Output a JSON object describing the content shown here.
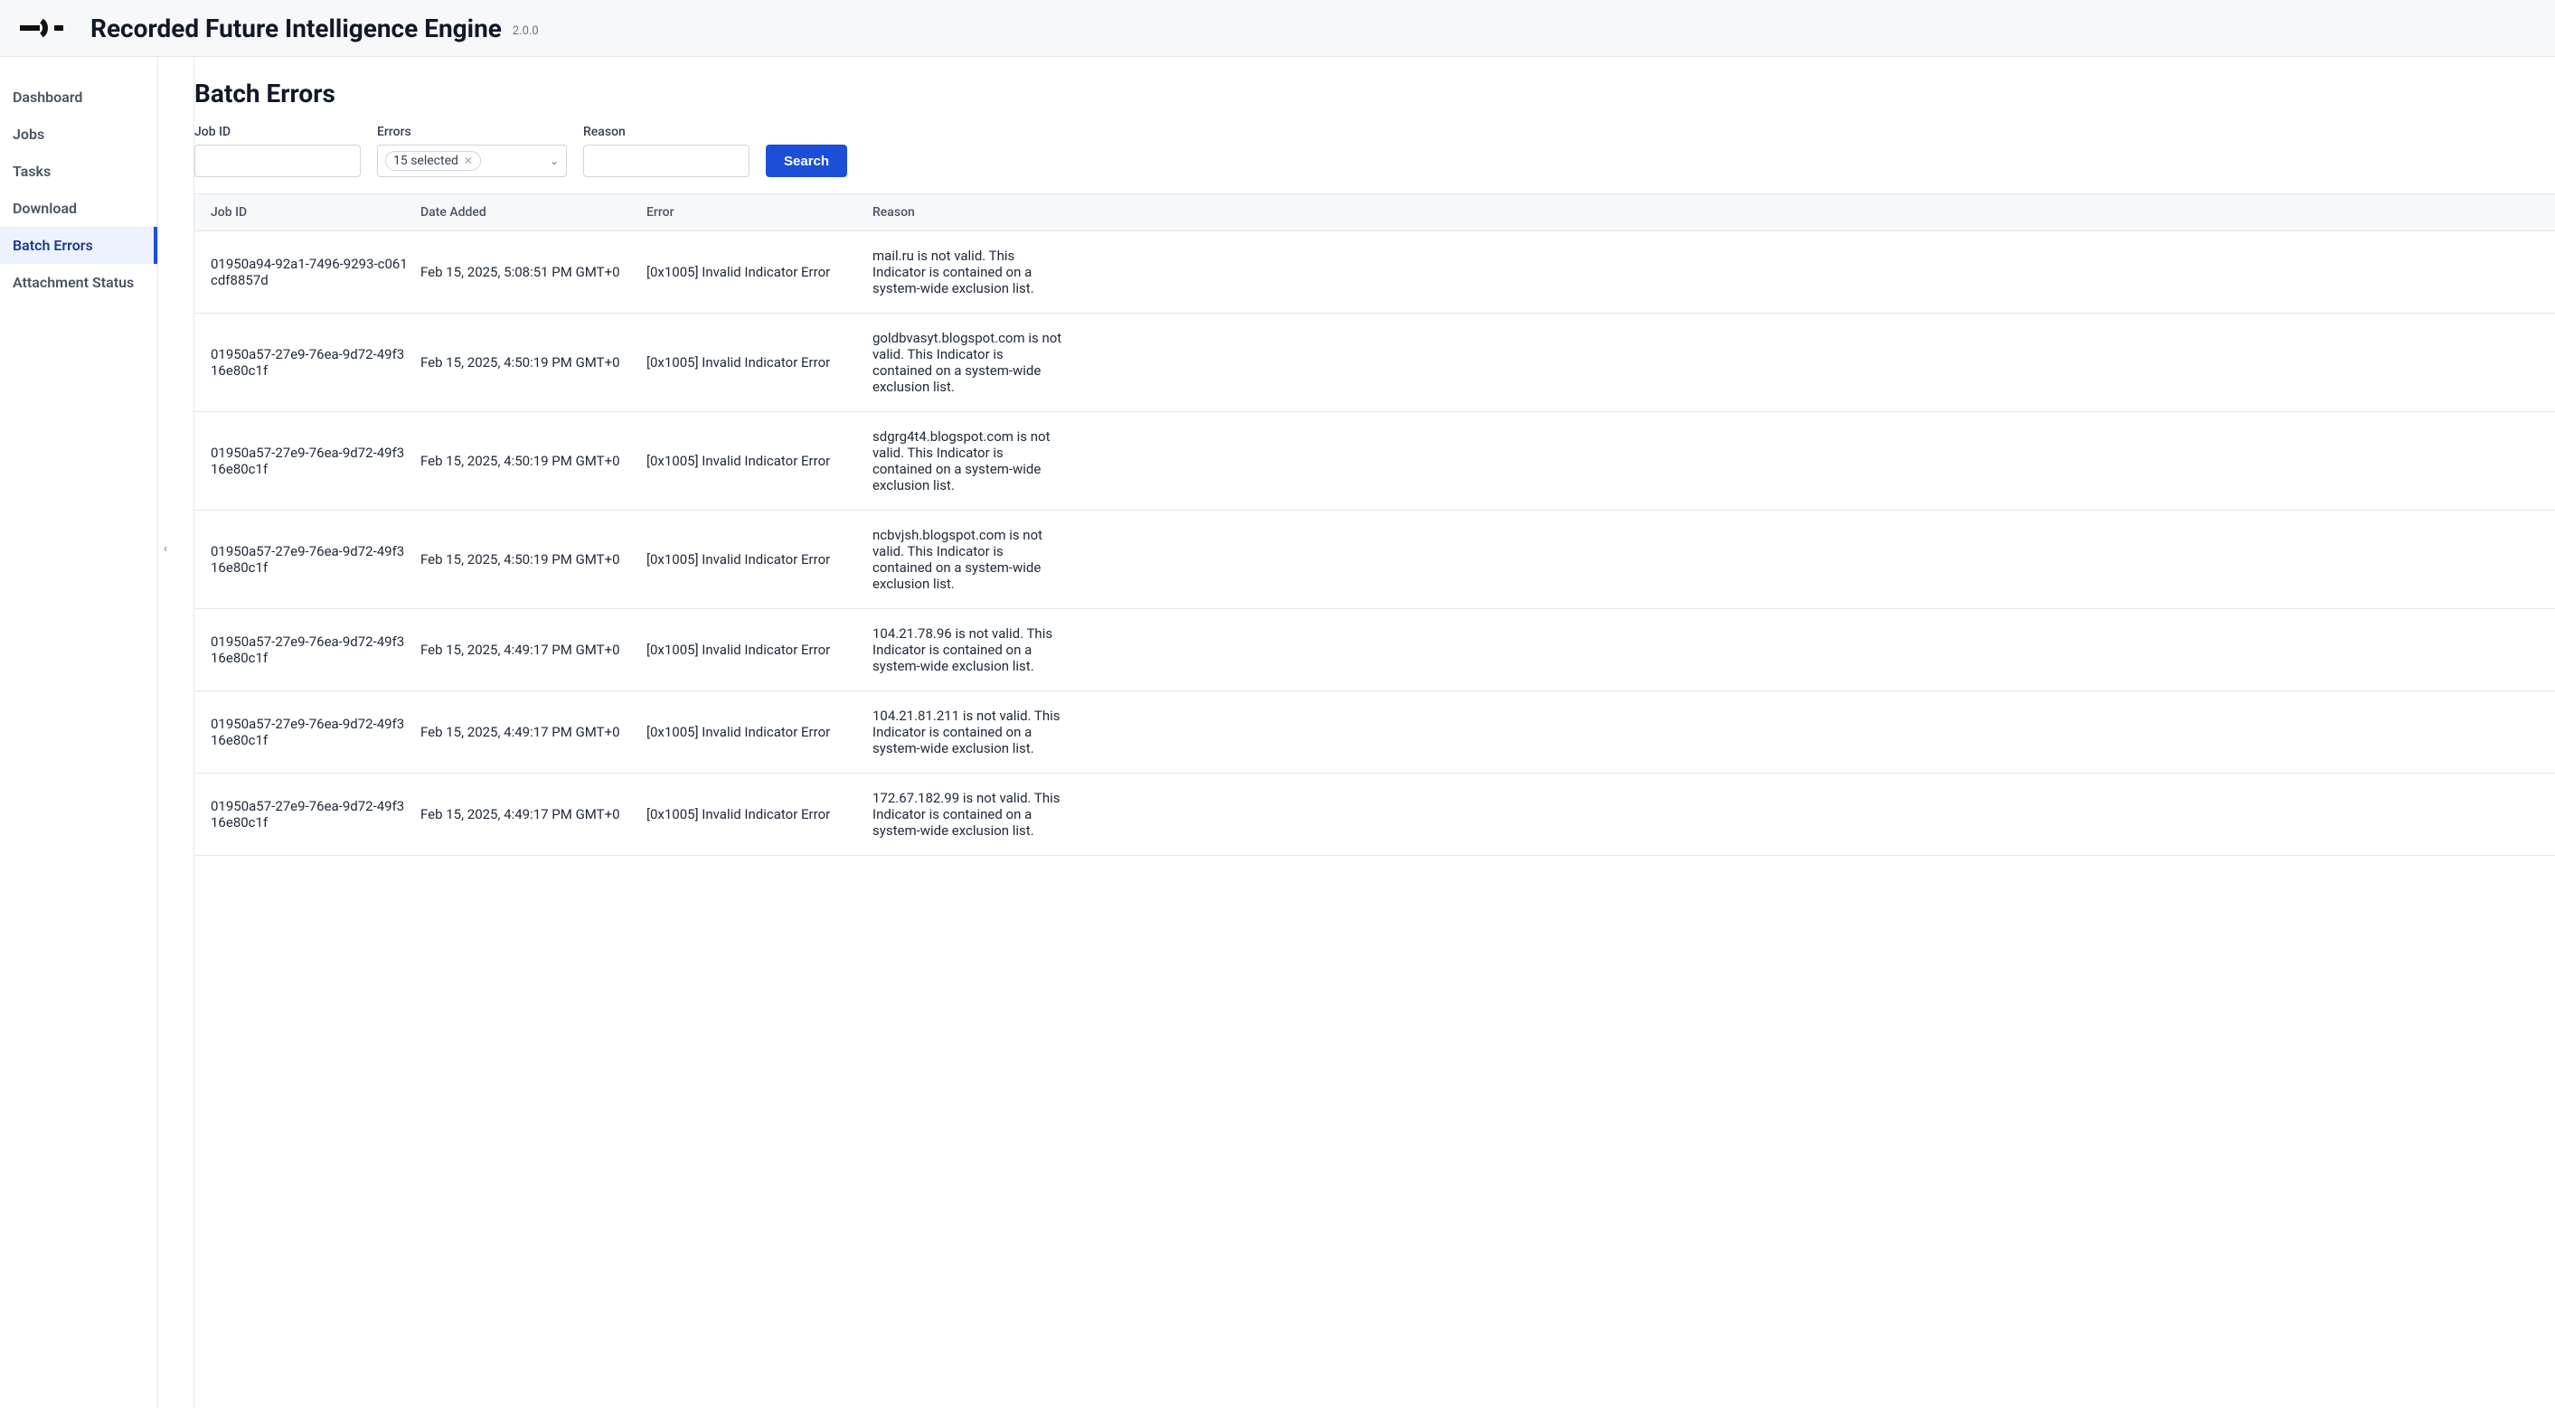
{
  "header": {
    "title": "Recorded Future Intelligence Engine",
    "version": "2.0.0"
  },
  "sidebar": {
    "items": [
      {
        "label": "Dashboard",
        "active": false
      },
      {
        "label": "Jobs",
        "active": false
      },
      {
        "label": "Tasks",
        "active": false
      },
      {
        "label": "Download",
        "active": false
      },
      {
        "label": "Batch Errors",
        "active": true
      },
      {
        "label": "Attachment Status",
        "active": false
      }
    ]
  },
  "page": {
    "title": "Batch Errors"
  },
  "filters": {
    "job_id_label": "Job ID",
    "job_id_value": "",
    "errors_label": "Errors",
    "errors_selected_text": "15 selected",
    "reason_label": "Reason",
    "reason_value": "",
    "search_button": "Search"
  },
  "table": {
    "headers": {
      "job_id": "Job ID",
      "date_added": "Date Added",
      "error": "Error",
      "reason": "Reason"
    },
    "rows": [
      {
        "job_id": "01950a94-92a1-7496-9293-c061cdf8857d",
        "date_added": "Feb 15, 2025, 5:08:51 PM GMT+0",
        "error": "[0x1005] Invalid Indicator Error",
        "reason": "mail.ru is not valid. This Indicator is contained on a system-wide exclusion list."
      },
      {
        "job_id": "01950a57-27e9-76ea-9d72-49f316e80c1f",
        "date_added": "Feb 15, 2025, 4:50:19 PM GMT+0",
        "error": "[0x1005] Invalid Indicator Error",
        "reason": "goldbvasyt.blogspot.com is not valid. This Indicator is contained on a system-wide exclusion list."
      },
      {
        "job_id": "01950a57-27e9-76ea-9d72-49f316e80c1f",
        "date_added": "Feb 15, 2025, 4:50:19 PM GMT+0",
        "error": "[0x1005] Invalid Indicator Error",
        "reason": "sdgrg4t4.blogspot.com is not valid. This Indicator is contained on a system-wide exclusion list."
      },
      {
        "job_id": "01950a57-27e9-76ea-9d72-49f316e80c1f",
        "date_added": "Feb 15, 2025, 4:50:19 PM GMT+0",
        "error": "[0x1005] Invalid Indicator Error",
        "reason": "ncbvjsh.blogspot.com is not valid. This Indicator is contained on a system-wide exclusion list."
      },
      {
        "job_id": "01950a57-27e9-76ea-9d72-49f316e80c1f",
        "date_added": "Feb 15, 2025, 4:49:17 PM GMT+0",
        "error": "[0x1005] Invalid Indicator Error",
        "reason": "104.21.78.96 is not valid. This Indicator is contained on a system-wide exclusion list."
      },
      {
        "job_id": "01950a57-27e9-76ea-9d72-49f316e80c1f",
        "date_added": "Feb 15, 2025, 4:49:17 PM GMT+0",
        "error": "[0x1005] Invalid Indicator Error",
        "reason": "104.21.81.211 is not valid. This Indicator is contained on a system-wide exclusion list."
      },
      {
        "job_id": "01950a57-27e9-76ea-9d72-49f316e80c1f",
        "date_added": "Feb 15, 2025, 4:49:17 PM GMT+0",
        "error": "[0x1005] Invalid Indicator Error",
        "reason": "172.67.182.99 is not valid. This Indicator is contained on a system-wide exclusion list."
      }
    ]
  }
}
